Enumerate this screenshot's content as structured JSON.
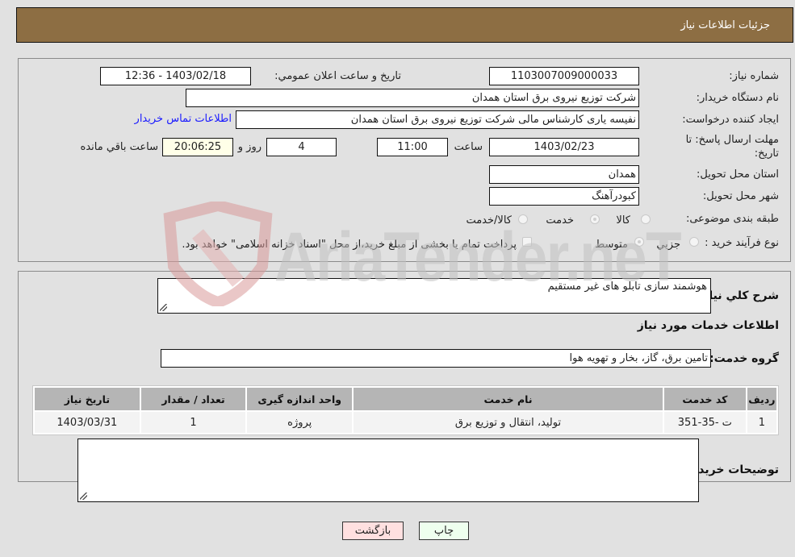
{
  "header": {
    "title": "جزئیات اطلاعات نیاز"
  },
  "details": {
    "need_number_label": "شماره نیاز:",
    "need_number": "1103007009000033",
    "announce_label": "تاریخ و ساعت اعلان عمومي:",
    "announce_value": "1403/02/18 - 12:36",
    "buyer_org_label": "نام دستگاه خریدار:",
    "buyer_org": "شرکت توزیع نیروی برق استان همدان",
    "creator_label": "ایجاد کننده درخواست:",
    "creator": "نفیسه یاری کارشناس مالی شرکت توزیع نیروی برق استان همدان",
    "contact_link": "اطلاعات تماس خریدار",
    "deadline_label": "مهلت ارسال پاسخ: تا تاریخ:",
    "deadline_date": "1403/02/23",
    "time_label": "ساعت",
    "deadline_time": "11:00",
    "days_value": "4",
    "days_label": "روز و",
    "remaining_time": "20:06:25",
    "remaining_label": "ساعت باقي مانده",
    "province_label": "استان محل تحویل:",
    "province": "همدان",
    "city_label": "شهر محل تحویل:",
    "city": "کبودرآهنگ",
    "category_label": "طبقه بندی موضوعی:",
    "category_options": [
      {
        "label": "کالا",
        "checked": false
      },
      {
        "label": "خدمت",
        "checked": true
      },
      {
        "label": "کالا/خدمت",
        "checked": false
      }
    ],
    "process_label": "نوع فرآیند خرید :",
    "process_options": [
      {
        "label": "جزيي",
        "checked": false
      },
      {
        "label": "متوسط",
        "checked": true
      }
    ],
    "treasury_note": "پرداخت تمام یا بخشی از مبلغ خرید،از محل \"اسناد خزانه اسلامی\" خواهد بود."
  },
  "summary": {
    "description_label": "شرح کلي نیاز:",
    "description": "هوشمند سازی تابلو های غیر مستقیم",
    "services_heading": "اطلاعات خدمات مورد نیاز",
    "service_group_label": "گروه خدمت:",
    "service_group": "تامین برق، گاز، بخار و تهویه هوا",
    "table": {
      "headers": [
        "ردیف",
        "کد خدمت",
        "نام خدمت",
        "واحد اندازه گیری",
        "تعداد / مقدار",
        "تاریخ نیاز"
      ],
      "rows": [
        [
          "1",
          "ت -35-351",
          "تولید، انتقال و توزیع برق",
          "پروژه",
          "1",
          "1403/03/31"
        ]
      ]
    },
    "buyer_notes_label": "توضیحات خریدار:",
    "buyer_notes": ""
  },
  "buttons": {
    "print": "چاپ",
    "back": "بازگشت"
  },
  "colors": {
    "header_bg": "#8d6e43",
    "print_bg": "#eeffee",
    "back_bg": "#ffe0e0",
    "link": "#1a1aff"
  },
  "watermark": {
    "text": "AriaTender.neT"
  }
}
